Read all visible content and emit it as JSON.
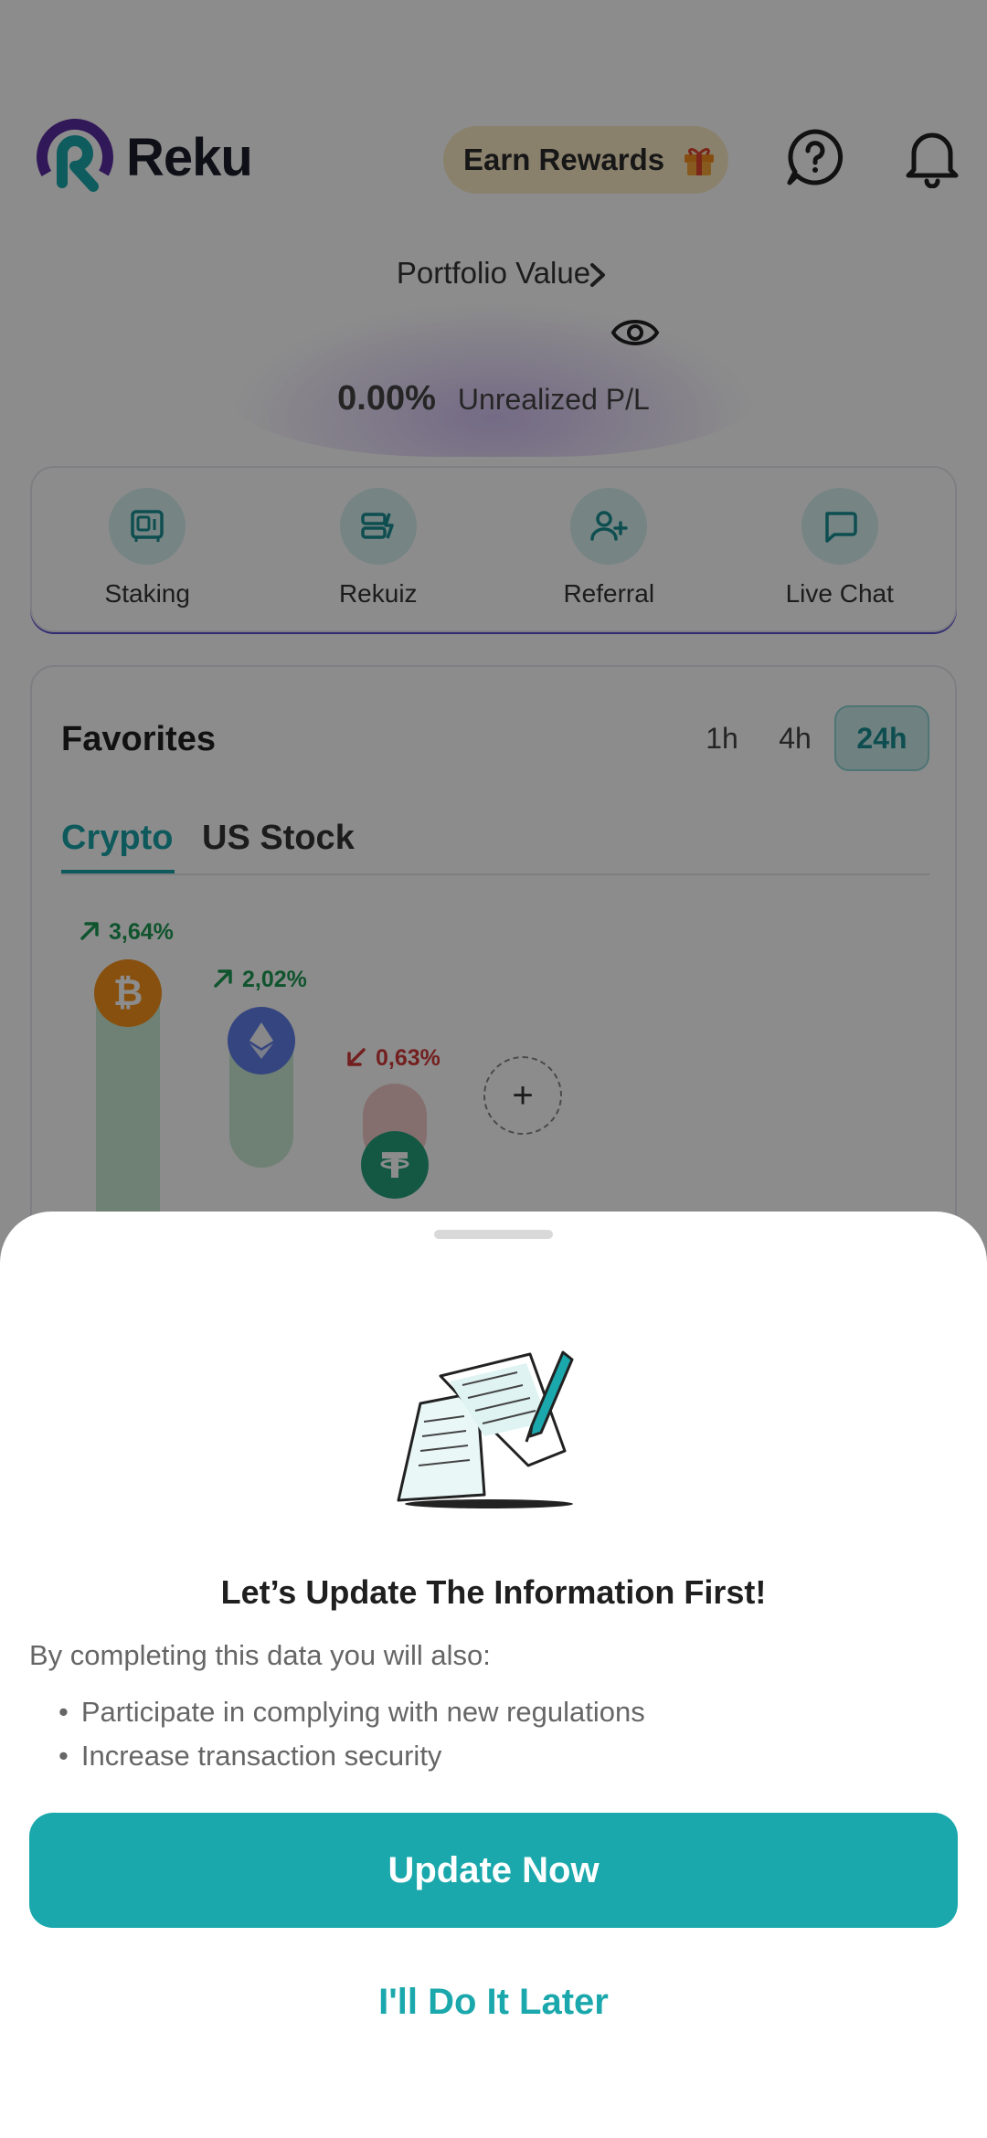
{
  "app": {
    "brand": "Reku",
    "earn_rewards": "Earn Rewards",
    "icons": {
      "help": "help-circle-icon",
      "notifications": "bell-icon",
      "gift": "gift-icon",
      "visibility": "eye-icon"
    }
  },
  "portfolio": {
    "title": "Portfolio Value",
    "chevron": "›",
    "pnl_value": "0.00%",
    "pnl_label": "Unrealized P/L"
  },
  "quick_actions": [
    {
      "label": "Staking",
      "icon": "vault-icon"
    },
    {
      "label": "Rekuiz",
      "icon": "quiz-icon"
    },
    {
      "label": "Referral",
      "icon": "add-user-icon"
    },
    {
      "label": "Live Chat",
      "icon": "chat-bubble-icon"
    }
  ],
  "favorites": {
    "title": "Favorites",
    "timeframes": [
      "1h",
      "4h",
      "24h"
    ],
    "selected_timeframe": "24h",
    "tabs": [
      "Crypto",
      "US Stock"
    ],
    "active_tab": "Crypto",
    "coins": [
      {
        "symbol": "BTC",
        "change": "3,64%",
        "direction": "up",
        "color": "#f7931a"
      },
      {
        "symbol": "ETH",
        "change": "2,02%",
        "direction": "up",
        "color": "#627eea"
      },
      {
        "symbol": "USDT",
        "change": "0,63%",
        "direction": "down",
        "color": "#26a17b"
      }
    ],
    "add_symbol": "+"
  },
  "sheet": {
    "title": "Let’s Update The Information First!",
    "intro": "By completing this data you will also:",
    "bullets": [
      "Participate in complying with new regulations",
      "Increase transaction security"
    ],
    "primary_button": "Update Now",
    "secondary_button": "I'll Do It Later",
    "illustration": "documents-pen-illustration"
  },
  "colors": {
    "primary": "#1ba8ac",
    "up": "#1e9a55",
    "down": "#d13a3a"
  }
}
